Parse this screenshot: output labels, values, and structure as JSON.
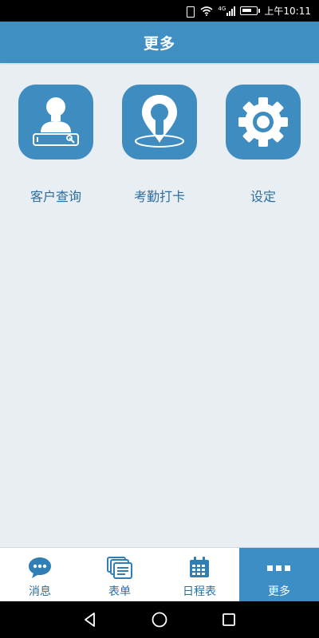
{
  "status_bar": {
    "signal_text": "4G",
    "time": "上午10:11",
    "icons": [
      "vibrate-icon",
      "wifi-icon",
      "signal-icon",
      "battery-icon"
    ]
  },
  "header": {
    "title": "更多"
  },
  "grid": {
    "items": [
      {
        "label": "客户查询",
        "icon": "customer-search-icon"
      },
      {
        "label": "考勤打卡",
        "icon": "location-pin-icon"
      },
      {
        "label": "设定",
        "icon": "gear-icon"
      }
    ]
  },
  "tabbar": {
    "items": [
      {
        "label": "消息",
        "icon": "chat-bubble-icon",
        "active": false
      },
      {
        "label": "表单",
        "icon": "forms-icon",
        "active": false
      },
      {
        "label": "日程表",
        "icon": "calendar-icon",
        "active": false
      },
      {
        "label": "更多",
        "icon": "more-dots-icon",
        "active": true
      }
    ]
  },
  "navbar": {
    "icons": [
      "back-icon",
      "home-icon",
      "recents-icon"
    ]
  },
  "colors": {
    "primary": "#3f8fc3",
    "tile": "#3f8cc0",
    "background": "#e9eef2",
    "label": "#2d6e9e"
  }
}
